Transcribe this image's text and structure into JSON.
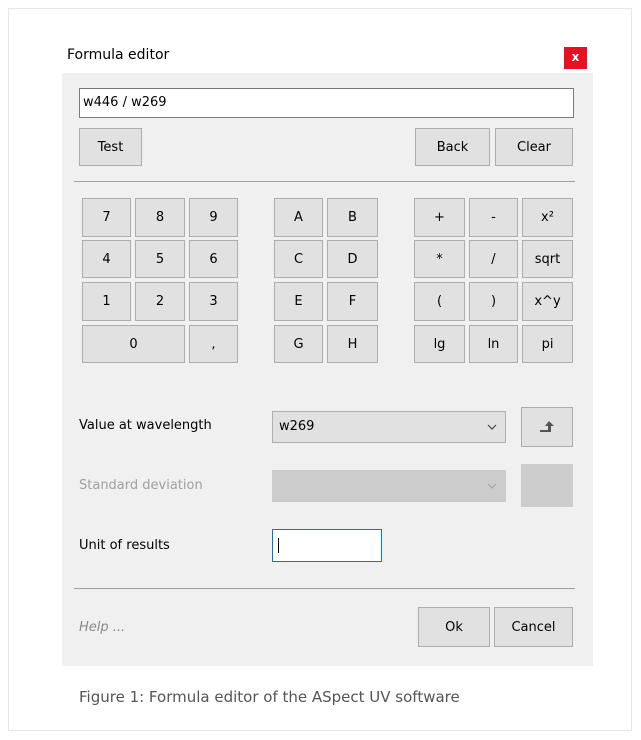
{
  "dialog": {
    "title": "Formula editor",
    "close_label": "x",
    "formula_value": "w446 / w269",
    "test_label": "Test",
    "back_label": "Back",
    "clear_label": "Clear",
    "keypad": {
      "digits": [
        "7",
        "8",
        "9",
        "4",
        "5",
        "6",
        "1",
        "2",
        "3",
        "0",
        ","
      ],
      "letters": [
        "A",
        "B",
        "C",
        "D",
        "E",
        "F",
        "G",
        "H"
      ],
      "operators": [
        "+",
        "-",
        "x²",
        "*",
        "/",
        "sqrt",
        "(",
        ")",
        "x^y",
        "lg",
        "ln",
        "pi"
      ]
    },
    "wavelength_label": "Value at wavelength",
    "wavelength_value": "w269",
    "std_dev_label": "Standard deviation",
    "std_dev_value": "",
    "unit_label": "Unit of results",
    "unit_value": "",
    "help_label": "Help ...",
    "ok_label": "Ok",
    "cancel_label": "Cancel"
  },
  "caption": "Figure 1: Formula editor of the ASpect UV software",
  "colors": {
    "close_bg": "#e81123",
    "dialog_bg": "#f0f0f0",
    "button_bg": "#e1e1e1",
    "focus_border": "#0078d7"
  }
}
